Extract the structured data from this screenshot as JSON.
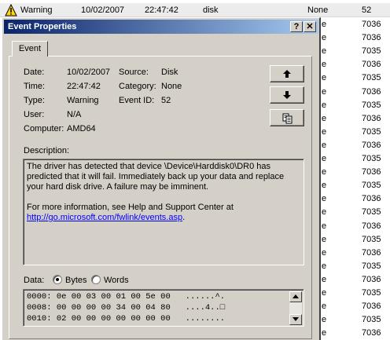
{
  "event_list": {
    "selected_row": {
      "type": "Warning",
      "date": "10/02/2007",
      "time": "22:47:42",
      "source": "disk",
      "category": "None",
      "event_id": "52"
    },
    "right_column": {
      "fragment": "e",
      "ids": [
        "7036",
        "7036",
        "7035",
        "7036",
        "7035",
        "7036",
        "7035",
        "7036",
        "7035",
        "7036",
        "7035",
        "7036",
        "7035",
        "7036",
        "7035",
        "7036",
        "7035",
        "7036",
        "7035",
        "7036",
        "7035",
        "7036",
        "7035",
        "7036"
      ]
    }
  },
  "dialog": {
    "title": "Event Properties",
    "help_label": "?",
    "close_label": "✕",
    "tab_label": "Event",
    "fields": {
      "date_label": "Date:",
      "date": "10/02/2007",
      "source_label": "Source:",
      "source": "Disk",
      "time_label": "Time:",
      "time": "22:47:42",
      "category_label": "Category:",
      "category": "None",
      "type_label": "Type:",
      "type": "Warning",
      "event_id_label": "Event ID:",
      "event_id": "52",
      "user_label": "User:",
      "user": "N/A",
      "computer_label": "Computer:",
      "computer": "AMD64"
    },
    "description_label": "Description:",
    "description_p1": "The driver has detected that device \\Device\\Harddisk0\\DR0 has predicted that it will fail.  Immediately back up your data and replace your hard disk drive. A failure  may be imminent.",
    "description_p2": "For more information, see Help and Support Center at",
    "description_link": "http://go.microsoft.com/fwlink/events.asp",
    "description_link_suffix": ".",
    "data_label": "Data:",
    "bytes_label": "Bytes",
    "words_label": "Words",
    "data_mode": "Bytes",
    "hex_rows": [
      {
        "offset": "0000:",
        "bytes": "0e 00 03 00 01 00 5e 00",
        "ascii": "......^."
      },
      {
        "offset": "0008:",
        "bytes": "00 00 00 00 34 00 04 80",
        "ascii": "....4..□"
      },
      {
        "offset": "0010:",
        "bytes": "02 00 00 00 00 00 00 00",
        "ascii": "........"
      }
    ]
  },
  "icons": {
    "warning": "warning-icon",
    "up": "arrow-up-icon",
    "down": "arrow-down-icon",
    "copy": "copy-icon"
  }
}
